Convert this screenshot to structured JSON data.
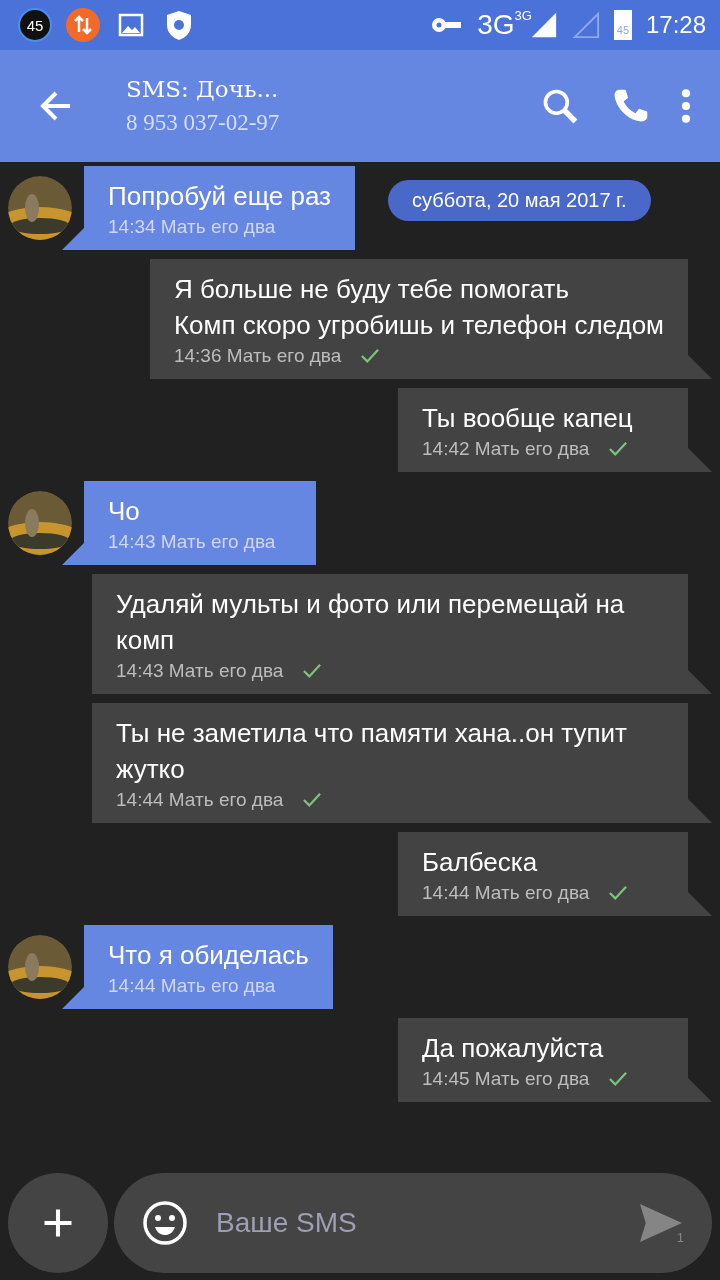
{
  "status_bar": {
    "notification_count": "45",
    "battery": "45",
    "network": "3G",
    "network_small": "3G",
    "time": "17:28"
  },
  "header": {
    "title": "SMS: Дочь...",
    "phone": "8 953 037-02-97"
  },
  "date_chip": "суббота, 20 мая 2017 г.",
  "messages": [
    {
      "kind": "in",
      "lines": [
        "Попробуй еще раз"
      ],
      "time": "14:34",
      "sender": "Мать его два"
    },
    {
      "kind": "out",
      "lines": [
        "Я больше не буду тебе помогать",
        "Комп скоро угробишь и телефон следом"
      ],
      "time": "14:36",
      "sender": "Мать его два",
      "delivered": true
    },
    {
      "kind": "out",
      "lines": [
        "Ты вообще капец"
      ],
      "time": "14:42",
      "sender": "Мать его два",
      "delivered": true
    },
    {
      "kind": "in",
      "lines": [
        "Чо"
      ],
      "time": "14:43",
      "sender": "Мать его два"
    },
    {
      "kind": "out",
      "lines": [
        "Удаляй мульты и фото или перемещай на комп"
      ],
      "time": "14:43",
      "sender": "Мать его два",
      "delivered": true
    },
    {
      "kind": "out",
      "lines": [
        "Ты не заметила что памяти хана..он тупит жутко"
      ],
      "time": "14:44",
      "sender": "Мать его два",
      "delivered": true
    },
    {
      "kind": "out",
      "lines": [
        "Балбеска"
      ],
      "time": "14:44",
      "sender": "Мать его два",
      "delivered": true
    },
    {
      "kind": "in",
      "lines": [
        "Что я обиделась"
      ],
      "time": "14:44",
      "sender": "Мать его два"
    },
    {
      "kind": "out",
      "lines": [
        "Да пожалуйста"
      ],
      "time": "14:45",
      "sender": "Мать его два",
      "delivered": true
    }
  ],
  "composer": {
    "placeholder": "Ваше SMS",
    "sim": "1"
  }
}
